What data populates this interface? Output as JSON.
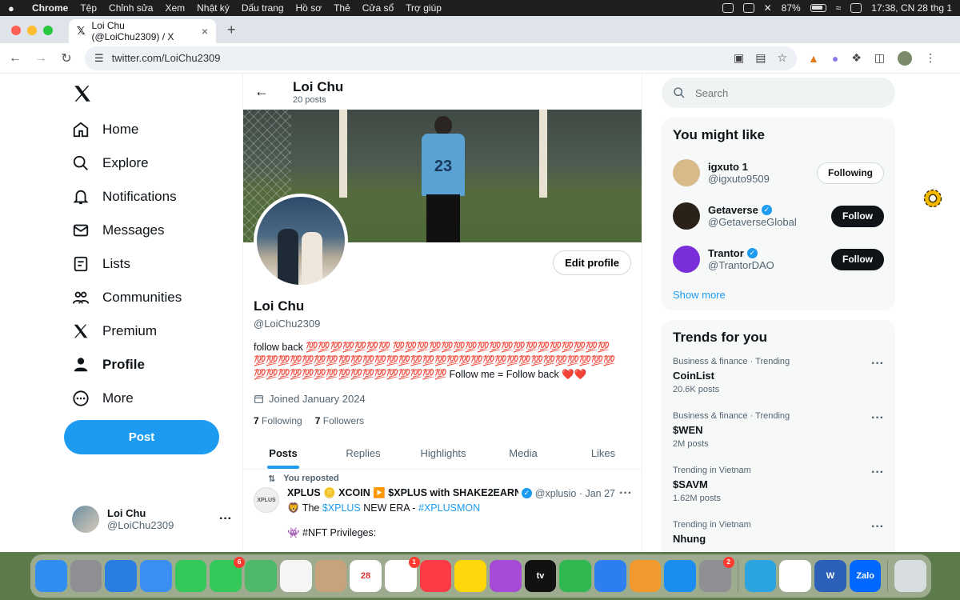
{
  "menubar": {
    "app": "Chrome",
    "items": [
      "Tệp",
      "Chỉnh sửa",
      "Xem",
      "Nhật ký",
      "Dấu trang",
      "Hồ sơ",
      "Thẻ",
      "Cửa sổ",
      "Trợ giúp"
    ],
    "battery": "87%",
    "clock": "17:38, CN 28 thg 1"
  },
  "browser": {
    "tab_title": "Loi Chu (@LoiChu2309) / X",
    "url": "twitter.com/LoiChu2309"
  },
  "nav": {
    "items": [
      {
        "label": "Home",
        "icon": "home-icon"
      },
      {
        "label": "Explore",
        "icon": "search-icon"
      },
      {
        "label": "Notifications",
        "icon": "bell-icon"
      },
      {
        "label": "Messages",
        "icon": "mail-icon"
      },
      {
        "label": "Lists",
        "icon": "list-icon"
      },
      {
        "label": "Communities",
        "icon": "people-icon"
      },
      {
        "label": "Premium",
        "icon": "x-logo-icon"
      },
      {
        "label": "Profile",
        "icon": "person-icon"
      },
      {
        "label": "More",
        "icon": "more-circle-icon"
      }
    ],
    "post_label": "Post",
    "account_name": "Loi Chu",
    "account_handle": "@LoiChu2309"
  },
  "profile": {
    "name": "Loi Chu",
    "posts_count": "20 posts",
    "handle": "@LoiChu2309",
    "edit_label": "Edit profile",
    "bio_prefix": "follow back",
    "bio_emoji": "💯💯💯💯💯💯💯 💯💯💯💯💯💯💯💯💯💯💯💯💯💯💯💯💯💯💯💯💯💯💯💯💯💯💯💯💯💯💯💯💯💯💯💯💯💯💯💯💯💯💯💯💯💯💯💯💯💯💯💯💯💯💯💯💯💯💯💯💯💯💯💯",
    "bio_suffix": "Follow me = Follow back ❤️❤️",
    "joined": "Joined January 2024",
    "following_count": "7",
    "following_label": "Following",
    "followers_count": "7",
    "followers_label": "Followers",
    "jersey_number": "23"
  },
  "tabs": [
    "Posts",
    "Replies",
    "Highlights",
    "Media",
    "Likes"
  ],
  "tweet": {
    "repost_label": "You reposted",
    "author": "XPLUS 🪙 XCOIN ▶️ $XPLUS with SHAKE2EARN",
    "handle_time": "@xplusio · Jan 27",
    "avatar_text": "XPLUS",
    "line1_prefix": "🦁 The ",
    "line1_link1": "$XPLUS",
    "line1_mid": " NEW ERA - ",
    "line1_link2": "#XPLUSMON",
    "line2_prefix": "👾 ",
    "line2_link": "#NFT",
    "line2_suffix": " Privileges:"
  },
  "right": {
    "search_placeholder": "Search",
    "you_might_like": "You might like",
    "suggestions": [
      {
        "name": "igxuto 1",
        "handle": "@igxuto9509",
        "button": "Following",
        "verified": false,
        "color": "#d8b98a"
      },
      {
        "name": "Getaverse",
        "handle": "@GetaverseGlobal",
        "button": "Follow",
        "verified": true,
        "color": "#2a2118"
      },
      {
        "name": "Trantor",
        "handle": "@TrantorDAO",
        "button": "Follow",
        "verified": true,
        "color": "#7a2fd8"
      }
    ],
    "show_more": "Show more",
    "trends_title": "Trends for you",
    "trends": [
      {
        "category": "Business & finance · Trending",
        "title": "CoinList",
        "posts": "20.6K posts"
      },
      {
        "category": "Business & finance · Trending",
        "title": "$WEN",
        "posts": "2M posts"
      },
      {
        "category": "Trending in Vietnam",
        "title": "$SAVM",
        "posts": "1.62M posts"
      },
      {
        "category": "Trending in Vietnam",
        "title": "Nhung",
        "posts": ""
      }
    ]
  },
  "dock": {
    "apps": [
      {
        "name": "finder",
        "color": "#2f8ff0",
        "label": ""
      },
      {
        "name": "launchpad",
        "color": "#8e8e93",
        "label": ""
      },
      {
        "name": "safari",
        "color": "#2a7de1",
        "label": ""
      },
      {
        "name": "mail",
        "color": "#3b8ef2",
        "label": ""
      },
      {
        "name": "facetime",
        "color": "#34c759",
        "label": ""
      },
      {
        "name": "messages",
        "color": "#34c759",
        "label": "",
        "badge": "6"
      },
      {
        "name": "maps",
        "color": "#4db86a",
        "label": ""
      },
      {
        "name": "photos",
        "color": "#f5f5f5",
        "label": ""
      },
      {
        "name": "contacts",
        "color": "#c8a27a",
        "label": ""
      },
      {
        "name": "calendar",
        "color": "#ffffff",
        "label": "28"
      },
      {
        "name": "reminders",
        "color": "#ffffff",
        "label": "",
        "badge": "1"
      },
      {
        "name": "music",
        "color": "#fc3c44",
        "label": ""
      },
      {
        "name": "notes",
        "color": "#ffd60a",
        "label": ""
      },
      {
        "name": "podcasts",
        "color": "#a54bd8",
        "label": ""
      },
      {
        "name": "tv",
        "color": "#111111",
        "label": "tv"
      },
      {
        "name": "numbers",
        "color": "#2fb84f",
        "label": ""
      },
      {
        "name": "keynote",
        "color": "#2d7ff0",
        "label": ""
      },
      {
        "name": "pages",
        "color": "#f29a2e",
        "label": ""
      },
      {
        "name": "app-store",
        "color": "#1b8cf0",
        "label": ""
      },
      {
        "name": "system-settings",
        "color": "#8e8e93",
        "label": "",
        "badge": "2"
      },
      {
        "name": "telegram",
        "color": "#2aa3df",
        "label": ""
      },
      {
        "name": "chrome",
        "color": "#ffffff",
        "label": ""
      },
      {
        "name": "word",
        "color": "#2b5fb8",
        "label": "W"
      },
      {
        "name": "zalo",
        "color": "#0068ff",
        "label": "Zalo"
      },
      {
        "name": "trash",
        "color": "#d8dde0",
        "label": ""
      }
    ]
  }
}
